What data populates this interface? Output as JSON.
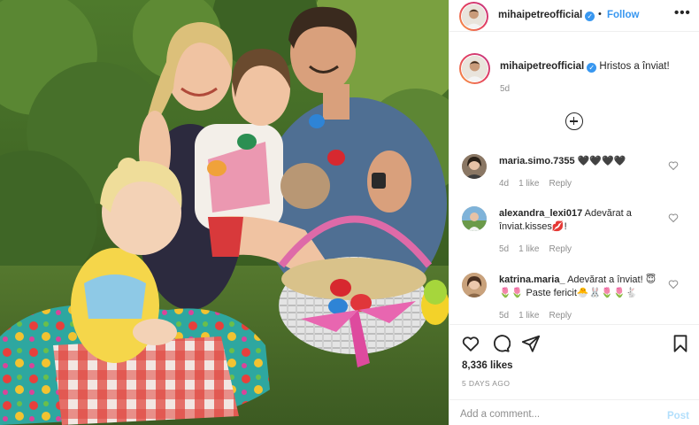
{
  "post": {
    "image_alt": "Family photo with Easter basket in garden"
  },
  "header": {
    "username": "mihaipetreofficial",
    "verified_glyph": "✓",
    "separator": "•",
    "follow_label": "Follow",
    "more_label": "•••"
  },
  "caption": {
    "username": "mihaipetreofficial",
    "verified_glyph": "✓",
    "text": "Hristos a înviat!",
    "time": "5d"
  },
  "comments": [
    {
      "username": "maria.simo.7355",
      "text": "🖤🖤🖤🖤",
      "time": "4d",
      "likes": "1 like",
      "reply_label": "Reply"
    },
    {
      "username": "alexandra_lexi017",
      "text": "Adevărat a înviat.kisses💋!",
      "time": "5d",
      "likes": "1 like",
      "reply_label": "Reply"
    },
    {
      "username": "katrina.maria_",
      "text": "Adevărat a înviat! 😇🌷🌷 Paste fericit🐣🐰🌷🌷🐇",
      "time": "5d",
      "likes": "1 like",
      "reply_label": "Reply"
    }
  ],
  "actions": {
    "like_icon": "heart-icon",
    "comment_icon": "comment-icon",
    "share_icon": "share-icon",
    "save_icon": "bookmark-icon",
    "likes": "8,336 likes",
    "date": "5 DAYS AGO"
  },
  "add_comment": {
    "placeholder": "Add a comment...",
    "post_label": "Post"
  },
  "colors": {
    "accent": "#3897f0",
    "post_disabled": "#b2dffc",
    "muted": "#8e8e8e",
    "text": "#262626"
  }
}
